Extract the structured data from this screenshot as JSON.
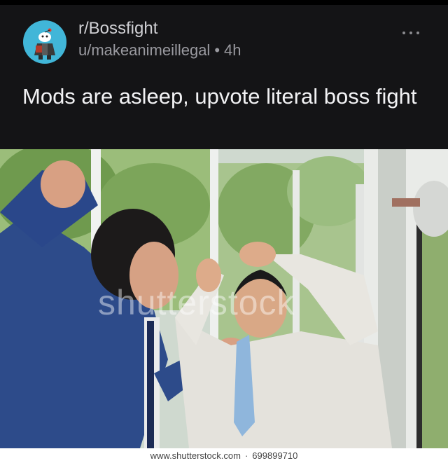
{
  "post": {
    "subreddit": "r/Bossfight",
    "username": "u/makeanimeillegal",
    "separator": "•",
    "age": "4h",
    "title": "Mods are asleep, upvote literal boss fight"
  },
  "image": {
    "watermark": "shutterstock",
    "footer_site": "www.shutterstock.com",
    "footer_id": "699899710"
  },
  "colors": {
    "background": "#141416",
    "avatar_bg": "#41b6d8",
    "title": "#f2f2f4",
    "subreddit": "#d0d0d4",
    "meta": "#9a9aa0"
  },
  "icons": {
    "avatar": "subreddit-avatar-icon",
    "more": "more-options-icon"
  }
}
